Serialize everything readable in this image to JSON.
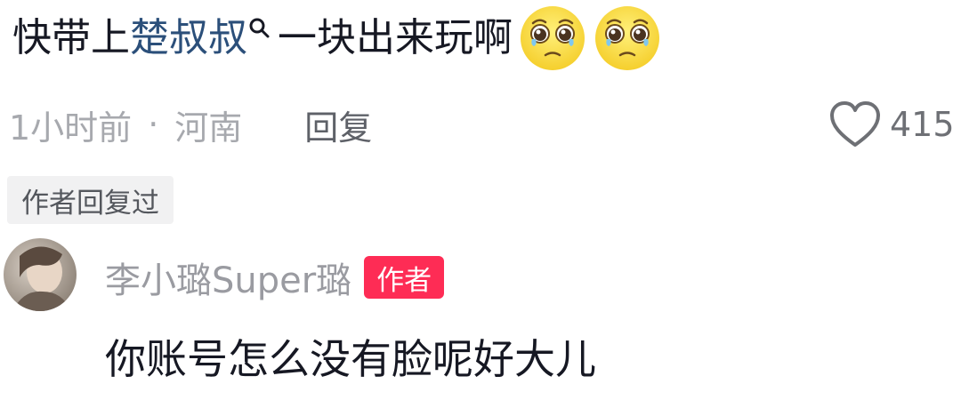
{
  "comment": {
    "text_before": "快带上",
    "mention": "楚叔叔",
    "text_after": "一块出来玩啊",
    "emojis": [
      "pleading-face-emoji",
      "pleading-face-emoji"
    ],
    "time": "1小时前",
    "separator": "·",
    "location": "河南",
    "reply_label": "回复",
    "likes": "415"
  },
  "author_replied_tag": "作者回复过",
  "reply": {
    "username": "李小璐Super璐",
    "badge": "作者",
    "text": "你账号怎么没有脸呢好大儿"
  },
  "colors": {
    "mention": "#2b4f7a",
    "badge": "#fe2c55",
    "meta": "#a7a9ae",
    "text": "#161823"
  },
  "icons": {
    "search": "search-icon",
    "like": "heart-icon",
    "avatar": "avatar"
  }
}
